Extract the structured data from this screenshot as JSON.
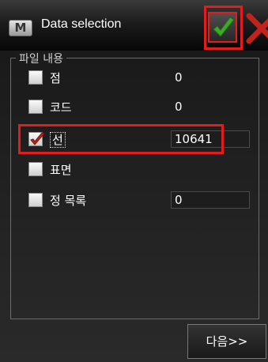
{
  "window": {
    "title": "Data selection",
    "app_icon_glyph": "M",
    "ok_icon": "checkmark-icon",
    "cancel_icon": "close-icon"
  },
  "group": {
    "legend": "파일 내용",
    "rows": [
      {
        "label": "점",
        "value": "0",
        "checked": false,
        "style": "text"
      },
      {
        "label": "코드",
        "value": "0",
        "checked": false,
        "style": "text"
      },
      {
        "label": "선",
        "value": "10641",
        "checked": true,
        "style": "field"
      },
      {
        "label": "표면",
        "value": "",
        "checked": false,
        "style": "none"
      },
      {
        "label": "정 목록",
        "value": "0",
        "checked": false,
        "style": "field"
      }
    ]
  },
  "footer": {
    "next_label": "다음>>"
  },
  "colors": {
    "highlight": "#e41c1c",
    "check_green": "#3fa82a",
    "check_red": "#c0231b"
  }
}
